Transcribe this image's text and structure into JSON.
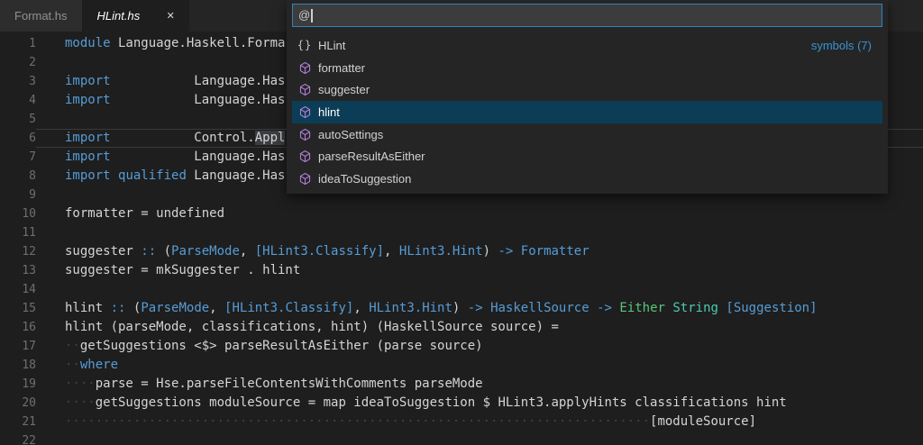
{
  "tabs": [
    {
      "label": "Format.hs",
      "active": false,
      "close_icon": null
    },
    {
      "label": "HLint.hs",
      "active": true,
      "close_icon": "✕"
    }
  ],
  "quick_open": {
    "query": "@",
    "items": [
      {
        "icon": "braces-icon",
        "label": "HLint",
        "badge": "symbols (7)",
        "selected": false
      },
      {
        "icon": "cube-icon",
        "label": "formatter",
        "badge": null,
        "selected": false
      },
      {
        "icon": "cube-icon",
        "label": "suggester",
        "badge": null,
        "selected": false
      },
      {
        "icon": "cube-icon",
        "label": "hlint",
        "badge": null,
        "selected": true
      },
      {
        "icon": "cube-icon",
        "label": "autoSettings",
        "badge": null,
        "selected": false
      },
      {
        "icon": "cube-icon",
        "label": "parseResultAsEither",
        "badge": null,
        "selected": false
      },
      {
        "icon": "cube-icon",
        "label": "ideaToSuggestion",
        "badge": null,
        "selected": false
      }
    ]
  },
  "colors": {
    "editor_bg": "#1e1e1e",
    "tabbar_bg": "#252526",
    "keyword_blue": "#569cd6",
    "type_blue": "#569cd6",
    "green": "#57c87a",
    "teal": "#4ec9b0",
    "selection_inactive": "#3a3d41",
    "list_selected_bg": "#0b3d56",
    "badge_blue": "#3794d1",
    "symbol_icon_purple": "#b180d7",
    "input_border_blue": "#3183bd"
  },
  "editor": {
    "lines": [
      {
        "num": 1,
        "current": false,
        "tokens": [
          [
            "k",
            "module"
          ],
          [
            "w",
            " Language.Haskell.Forma"
          ]
        ]
      },
      {
        "num": 2,
        "current": false,
        "tokens": []
      },
      {
        "num": 3,
        "current": false,
        "tokens": [
          [
            "k",
            "import"
          ],
          [
            "w",
            "           Language.Has"
          ]
        ]
      },
      {
        "num": 4,
        "current": false,
        "tokens": [
          [
            "k",
            "import"
          ],
          [
            "w",
            "           Language.Has"
          ]
        ]
      },
      {
        "num": 5,
        "current": false,
        "tokens": []
      },
      {
        "num": 6,
        "current": true,
        "tokens": [
          [
            "k",
            "import"
          ],
          [
            "w",
            "           Control."
          ],
          [
            "sel",
            "Appl"
          ]
        ]
      },
      {
        "num": 7,
        "current": false,
        "tokens": [
          [
            "k",
            "import"
          ],
          [
            "w",
            "           Language.Has"
          ]
        ]
      },
      {
        "num": 8,
        "current": false,
        "tokens": [
          [
            "k",
            "import"
          ],
          [
            "w",
            " "
          ],
          [
            "k",
            "qualified"
          ],
          [
            "w",
            " Language.Has"
          ]
        ]
      },
      {
        "num": 9,
        "current": false,
        "tokens": []
      },
      {
        "num": 10,
        "current": false,
        "tokens": [
          [
            "w",
            "formatter = undefined"
          ]
        ]
      },
      {
        "num": 11,
        "current": false,
        "tokens": []
      },
      {
        "num": 12,
        "current": false,
        "tokens": [
          [
            "w",
            "suggester "
          ],
          [
            "k",
            ":: "
          ],
          [
            "w",
            "("
          ],
          [
            "t",
            "ParseMode"
          ],
          [
            "w",
            ", "
          ],
          [
            "t",
            "[HLint3.Classify]"
          ],
          [
            "w",
            ", "
          ],
          [
            "t",
            "HLint3.Hint"
          ],
          [
            "w",
            ") "
          ],
          [
            "k",
            "-> "
          ],
          [
            "t",
            "Formatter"
          ]
        ]
      },
      {
        "num": 13,
        "current": false,
        "tokens": [
          [
            "w",
            "suggester = mkSuggester . hlint"
          ]
        ]
      },
      {
        "num": 14,
        "current": false,
        "tokens": []
      },
      {
        "num": 15,
        "current": false,
        "tokens": [
          [
            "w",
            "hlint "
          ],
          [
            "k",
            ":: "
          ],
          [
            "w",
            "("
          ],
          [
            "t",
            "ParseMode"
          ],
          [
            "w",
            ", "
          ],
          [
            "t",
            "[HLint3.Classify]"
          ],
          [
            "w",
            ", "
          ],
          [
            "t",
            "HLint3.Hint"
          ],
          [
            "w",
            ") "
          ],
          [
            "k",
            "-> "
          ],
          [
            "t",
            "HaskellSource"
          ],
          [
            "k",
            " -> "
          ],
          [
            "g",
            "Either"
          ],
          [
            "w",
            " "
          ],
          [
            "tl",
            "String"
          ],
          [
            "w",
            " "
          ],
          [
            "t",
            "[Suggestion]"
          ]
        ]
      },
      {
        "num": 16,
        "current": false,
        "tokens": [
          [
            "w",
            "hlint (parseMode, classifications, hint) (HaskellSource source) ="
          ]
        ]
      },
      {
        "num": 17,
        "current": false,
        "tokens": [
          [
            "ws",
            "··"
          ],
          [
            "w",
            "getSuggestions <$> parseResultAsEither (parse source)"
          ]
        ]
      },
      {
        "num": 18,
        "current": false,
        "tokens": [
          [
            "ws",
            "··"
          ],
          [
            "k",
            "where"
          ]
        ]
      },
      {
        "num": 19,
        "current": false,
        "tokens": [
          [
            "ws",
            "····"
          ],
          [
            "w",
            "parse = Hse.parseFileContentsWithComments parseMode"
          ]
        ]
      },
      {
        "num": 20,
        "current": false,
        "tokens": [
          [
            "ws",
            "····"
          ],
          [
            "w",
            "getSuggestions moduleSource = map ideaToSuggestion $ HLint3.applyHints classifications hint"
          ]
        ]
      },
      {
        "num": 21,
        "current": false,
        "tokens": [
          [
            "ws",
            "·············································································"
          ],
          [
            "w",
            "[moduleSource]"
          ]
        ]
      },
      {
        "num": 22,
        "current": false,
        "tokens": []
      }
    ]
  }
}
